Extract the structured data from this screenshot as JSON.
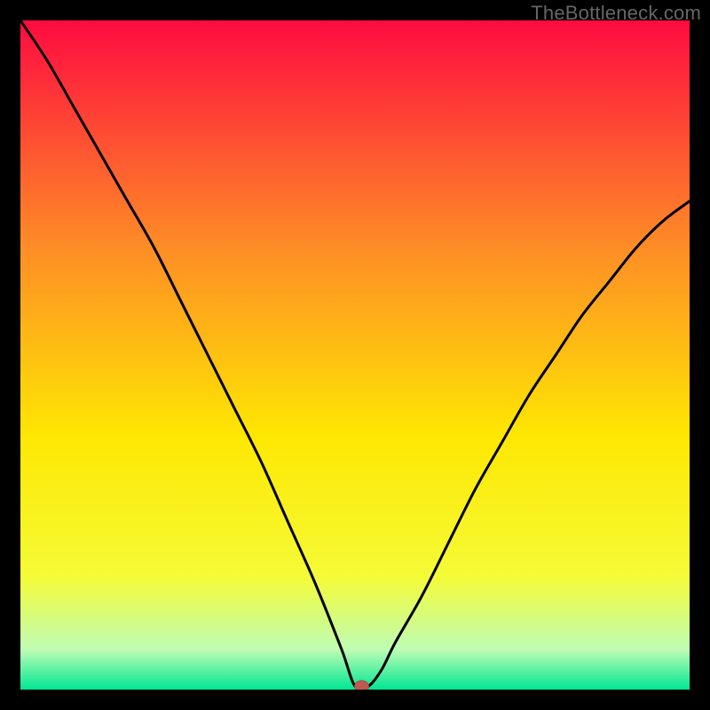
{
  "attribution": "TheBottleneck.com",
  "colors": {
    "gradient_top": "#fe0b40",
    "gradient_mid_upper": "#fe8d26",
    "gradient_mid": "#fee702",
    "gradient_mid_lower": "#f5fb36",
    "gradient_low": "#bffdb4",
    "gradient_bottom": "#00e793",
    "curve": "#000000",
    "marker": "#c0594f",
    "frame_bg": "#000000"
  },
  "chart_data": {
    "type": "line",
    "title": "",
    "xlabel": "",
    "ylabel": "",
    "xlim": [
      0,
      100
    ],
    "ylim": [
      0,
      100
    ],
    "x": [
      0,
      4,
      8,
      12,
      16,
      20,
      24,
      28,
      32,
      36,
      40,
      44,
      48,
      50,
      52,
      54,
      56,
      60,
      64,
      68,
      72,
      76,
      80,
      84,
      88,
      92,
      96,
      100
    ],
    "values": [
      100,
      94,
      87,
      80,
      73,
      66,
      58,
      50,
      42,
      34,
      25,
      16,
      6,
      0.5,
      0.5,
      3,
      7,
      14,
      22,
      30,
      37,
      44,
      50,
      56,
      61,
      66,
      70,
      73
    ],
    "marker": {
      "x": 51,
      "y": 0.5
    },
    "notes": "Values estimated from pixel positions; y=0 is plot bottom, y=100 is plot top."
  }
}
